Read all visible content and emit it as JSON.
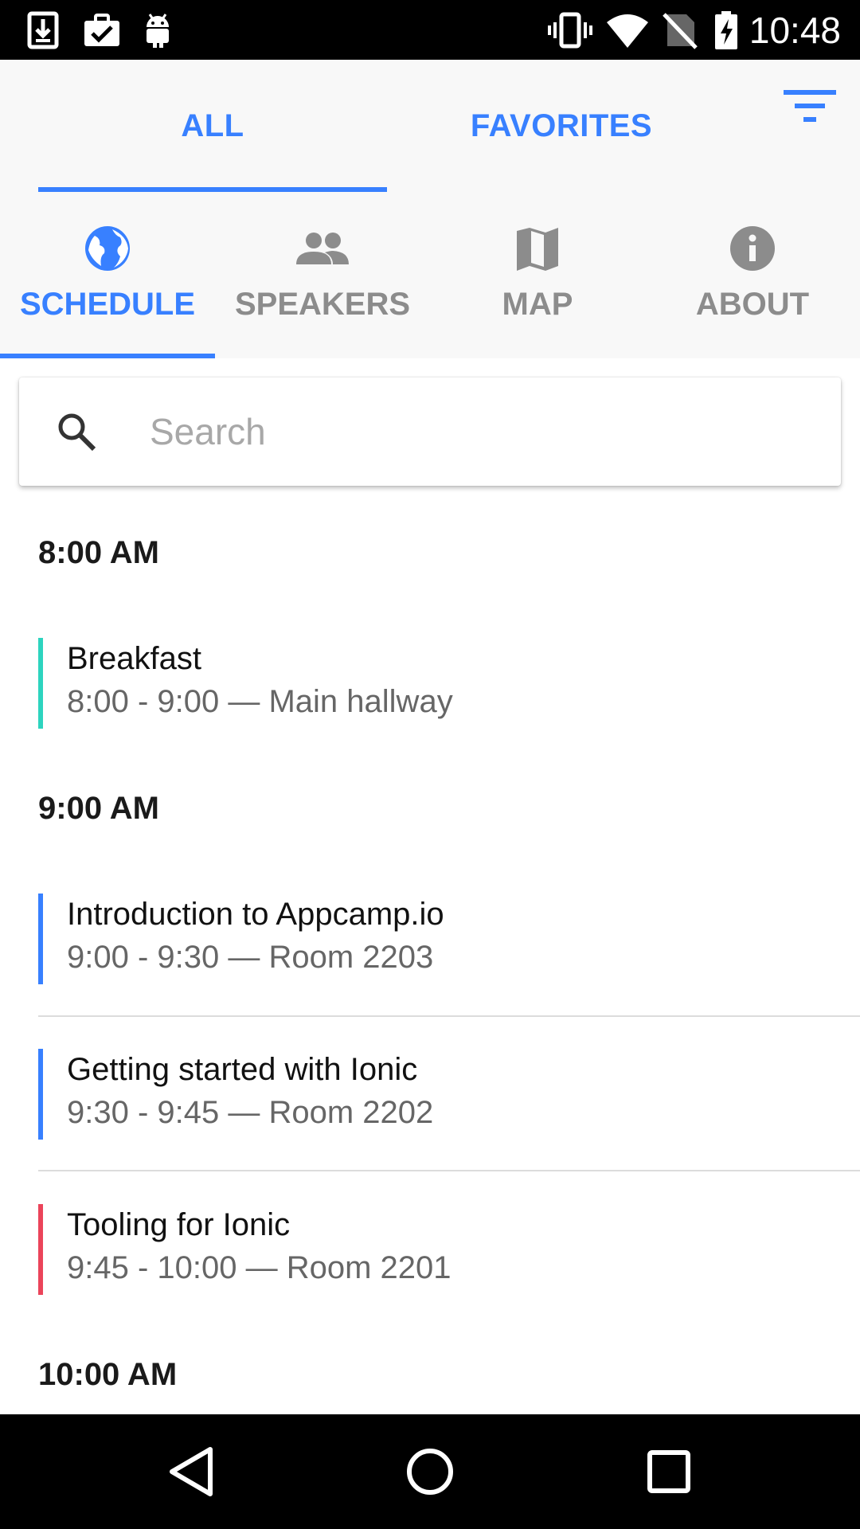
{
  "status_bar": {
    "time": "10:48",
    "left_icons": [
      "download-icon",
      "clipboard-check-icon",
      "android-icon"
    ],
    "right_icons": [
      "vibrate-icon",
      "wifi-icon",
      "no-sim-icon",
      "battery-charging-icon"
    ]
  },
  "segment": {
    "tabs": [
      {
        "label": "ALL",
        "active": true
      },
      {
        "label": "FAVORITES",
        "active": false
      }
    ],
    "filter_icon": "filter-icon"
  },
  "nav_tabs": [
    {
      "label": "SCHEDULE",
      "icon": "globe-icon",
      "active": true
    },
    {
      "label": "SPEAKERS",
      "icon": "people-icon",
      "active": false
    },
    {
      "label": "MAP",
      "icon": "map-icon",
      "active": false
    },
    {
      "label": "ABOUT",
      "icon": "info-icon",
      "active": false
    }
  ],
  "search": {
    "placeholder": "Search",
    "value": ""
  },
  "schedule": {
    "groups": [
      {
        "time": "8:00 AM",
        "sessions": [
          {
            "title": "Breakfast",
            "meta": "8:00 - 9:00 — Main hallway",
            "color": "#2dd4bf"
          }
        ]
      },
      {
        "time": "9:00 AM",
        "sessions": [
          {
            "title": "Introduction to Appcamp.io",
            "meta": "9:00 - 9:30 — Room 2203",
            "color": "#3880ff"
          },
          {
            "title": "Getting started with Ionic",
            "meta": "9:30 - 9:45 — Room 2202",
            "color": "#3880ff"
          },
          {
            "title": "Tooling for Ionic",
            "meta": "9:45 - 10:00 — Room 2201",
            "color": "#eb445a"
          }
        ]
      },
      {
        "time": "10:00 AM",
        "sessions": []
      }
    ]
  },
  "colors": {
    "primary": "#3880ff",
    "inactive": "#8c8c8c",
    "teal_track": "#2dd4bf",
    "red_track": "#eb445a"
  },
  "system_nav": [
    "back-icon",
    "home-icon",
    "recents-icon"
  ]
}
